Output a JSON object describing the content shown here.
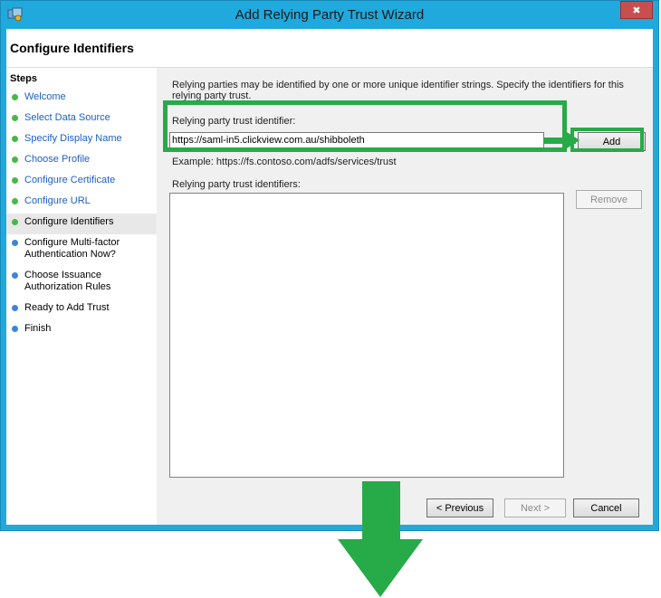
{
  "window": {
    "title": "Add Relying Party Trust Wizard",
    "close_glyph": "✖"
  },
  "header": {
    "title": "Configure Identifiers"
  },
  "steps": {
    "heading": "Steps",
    "items": [
      {
        "label": "Welcome",
        "state": "done"
      },
      {
        "label": "Select Data Source",
        "state": "done"
      },
      {
        "label": "Specify Display Name",
        "state": "done"
      },
      {
        "label": "Choose Profile",
        "state": "done"
      },
      {
        "label": "Configure Certificate",
        "state": "done"
      },
      {
        "label": "Configure URL",
        "state": "done"
      },
      {
        "label": "Configure Identifiers",
        "state": "current"
      },
      {
        "label": "Configure Multi-factor Authentication Now?",
        "state": "todo"
      },
      {
        "label": "Choose Issuance Authorization Rules",
        "state": "todo"
      },
      {
        "label": "Ready to Add Trust",
        "state": "todo"
      },
      {
        "label": "Finish",
        "state": "todo"
      }
    ]
  },
  "content": {
    "description": "Relying parties may be identified by one or more unique identifier strings. Specify the identifiers for this relying party trust.",
    "identifier_label": "Relying party trust identifier:",
    "identifier_value": "https://saml-in5.clickview.com.au/shibboleth",
    "add_label": "Add",
    "example": "Example: https://fs.contoso.com/adfs/services/trust",
    "identifiers_label": "Relying party trust identifiers:",
    "remove_label": "Remove"
  },
  "footer": {
    "previous_label": "< Previous",
    "next_label": "Next >",
    "cancel_label": "Cancel"
  },
  "colors": {
    "accent_frame": "#1fa9dc",
    "annotation_green": "#27aa48",
    "step_done": "#46b948",
    "step_todo": "#3e85d6"
  }
}
